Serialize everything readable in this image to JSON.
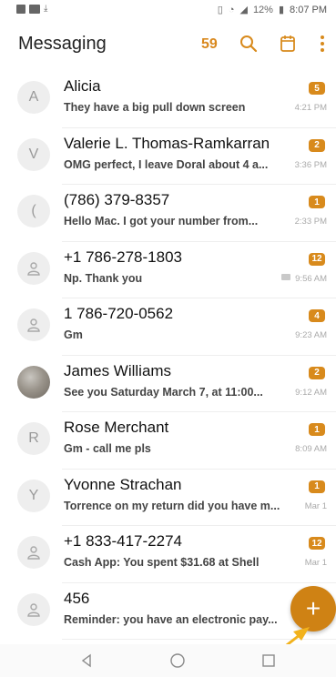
{
  "status_bar": {
    "battery": "12%",
    "time": "8:07 PM",
    "icons": [
      "notification-icon",
      "message-icon",
      "download-icon",
      "vibrate-icon",
      "wifi-icon",
      "signal-icon",
      "battery-icon"
    ]
  },
  "app_bar": {
    "title": "Messaging",
    "unread_count": "59",
    "icons": [
      "search-icon",
      "calendar-icon",
      "more-options-icon"
    ]
  },
  "conversations": [
    {
      "avatar": "A",
      "name": "Alicia",
      "preview": "They have a big pull down screen",
      "badge": "5",
      "time": "4:21 PM"
    },
    {
      "avatar": "V",
      "name": "Valerie L. Thomas-Ramkarran",
      "preview": "OMG perfect, I leave Doral about 4 a...",
      "badge": "2",
      "time": "3:36 PM"
    },
    {
      "avatar": "(",
      "name": "(786) 379-8357",
      "preview": "Hello Mac. I got your number from...",
      "badge": "1",
      "time": "2:33 PM"
    },
    {
      "avatar": "",
      "name": "+1 786-278-1803",
      "preview": "Np. Thank you",
      "badge": "12",
      "time": "9:56 AM"
    },
    {
      "avatar": "",
      "name": "1 786-720-0562",
      "preview": "Gm",
      "badge": "4",
      "time": "9:23 AM"
    },
    {
      "avatar": "",
      "name": "James Williams",
      "preview": "See you Saturday March 7, at 11:00...",
      "badge": "2",
      "time": "9:12 AM"
    },
    {
      "avatar": "R",
      "name": "Rose Merchant",
      "preview": "Gm - call me pls",
      "badge": "1",
      "time": "8:09 AM"
    },
    {
      "avatar": "Y",
      "name": "Yvonne Strachan",
      "preview": "Torrence on my return did you have m...",
      "badge": "1",
      "time": "Mar 1"
    },
    {
      "avatar": "",
      "name": "+1 833-417-2274",
      "preview": "Cash App: You spent $31.68 at Shell",
      "badge": "12",
      "time": "Mar 1"
    },
    {
      "avatar": "",
      "name": "456",
      "preview": "Reminder: you have an electronic pay...",
      "badge": "",
      "time": ""
    }
  ],
  "fab": {
    "label": "+"
  },
  "nav_bar": {
    "icons": [
      "back-icon",
      "home-icon",
      "recents-icon"
    ]
  },
  "colors": {
    "accent": "#d88a1c",
    "fab": "#cf8214",
    "arrow": "#f2b21c"
  }
}
